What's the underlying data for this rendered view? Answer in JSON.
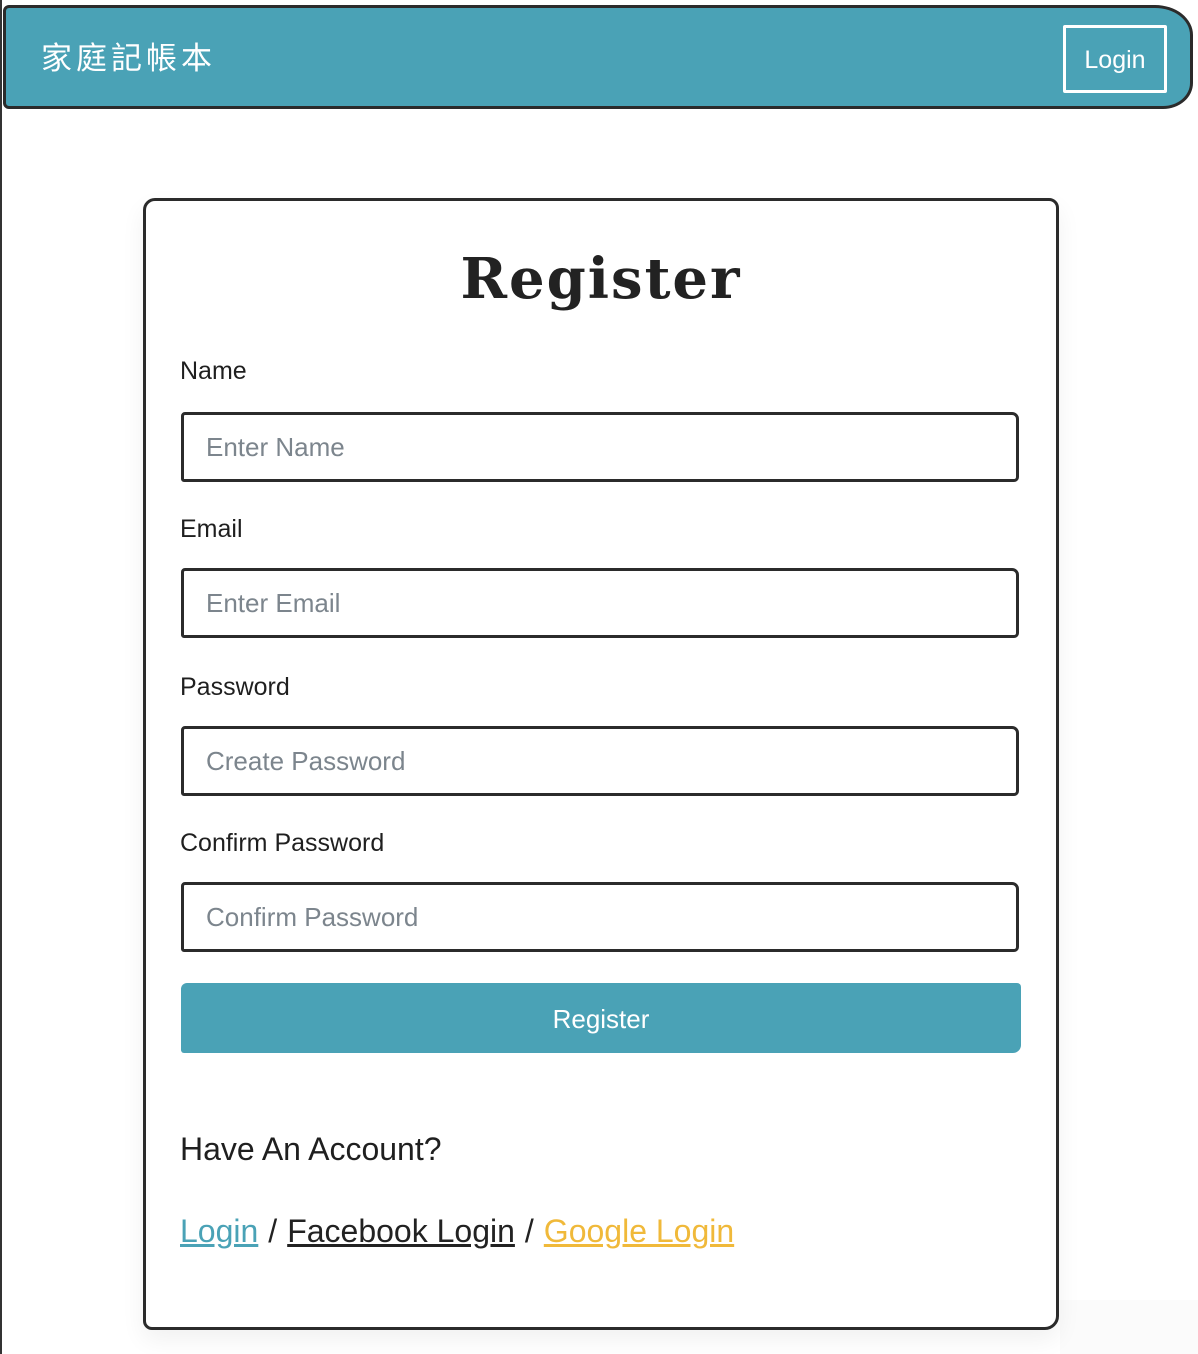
{
  "navbar": {
    "brand": "家庭記帳本",
    "login_label": "Login"
  },
  "form": {
    "title": "Register",
    "fields": [
      {
        "label": "Name",
        "placeholder": "Enter Name"
      },
      {
        "label": "Email",
        "placeholder": "Enter Email"
      },
      {
        "label": "Password",
        "placeholder": "Create Password"
      },
      {
        "label": "Confirm Password",
        "placeholder": "Confirm Password"
      }
    ],
    "submit_label": "Register"
  },
  "account": {
    "prompt": "Have An Account?",
    "separator": "/",
    "links": {
      "login": "Login",
      "facebook": "Facebook Login",
      "google": "Google Login"
    }
  },
  "colors": {
    "accent": "#4aa2b6",
    "google_link": "#f0b93a",
    "border": "#2b2b2b"
  }
}
